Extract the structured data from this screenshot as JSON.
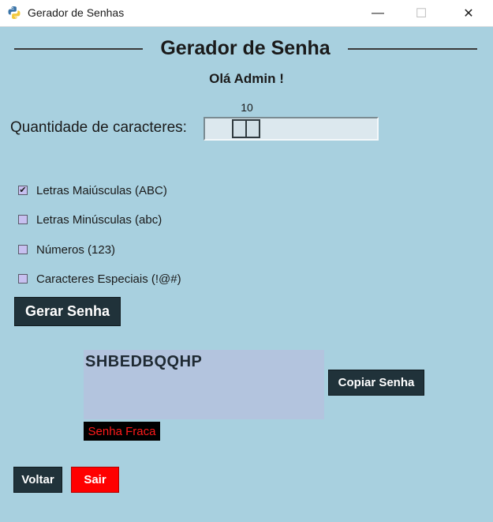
{
  "window": {
    "title": "Gerador de Senhas",
    "minimize_glyph": "—",
    "maximize_glyph": "☐",
    "close_glyph": "✕"
  },
  "header": {
    "title": "Gerador de Senha",
    "greeting": "Olá Admin !"
  },
  "length": {
    "label": "Quantidade de caracteres:",
    "value": "10"
  },
  "options": [
    {
      "label": "Letras Maiúsculas (ABC)",
      "checked": true
    },
    {
      "label": "Letras Minúsculas (abc)",
      "checked": false
    },
    {
      "label": "Números (123)",
      "checked": false
    },
    {
      "label": "Caracteres Especiais (!@#)",
      "checked": false
    }
  ],
  "buttons": {
    "generate": "Gerar Senha",
    "copy": "Copiar Senha",
    "back": "Voltar",
    "exit": "Sair"
  },
  "result": {
    "password": "SHBEDBQQHP",
    "strength": "Senha Fraca"
  },
  "colors": {
    "background": "#a8d0df",
    "button_dark": "#20323a",
    "button_exit": "#ff0000",
    "strength_text": "#ff1a1a"
  },
  "icons": {
    "app": "python-icon",
    "check": "checkmark-icon"
  }
}
